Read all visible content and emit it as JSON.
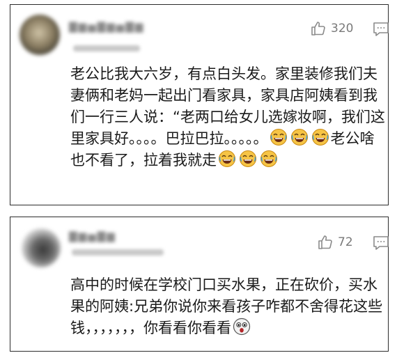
{
  "comments": [
    {
      "username": "▇▆▅▇▆▅▇▆",
      "likes": "320",
      "text_parts": [
        "老公比我大六岁，有点白头发。家里装修我们夫妻俩和老妈一起出门看家具，家具店阿姨看到我们一行三人说：“老两口给女儿选嫁妆啊，我们这里家具好。。。。巴拉巴拉。。。。。",
        "老公啥也不看了，拉着我就走"
      ],
      "icons": [
        "thumbs-up-icon",
        "comment-icon",
        "laugh-cry-emoji"
      ]
    },
    {
      "username": "▇▆▅▇▆",
      "likes": "72",
      "text_parts": [
        "高中的时候在学校门口买水果，正在砍价，买水果的阿姨:兄弟你说你来看孩子咋都不舍得花这些钱，，，，，，，你看看你看看"
      ],
      "icons": [
        "thumbs-up-icon",
        "comment-icon",
        "shocked-emoji"
      ]
    }
  ]
}
